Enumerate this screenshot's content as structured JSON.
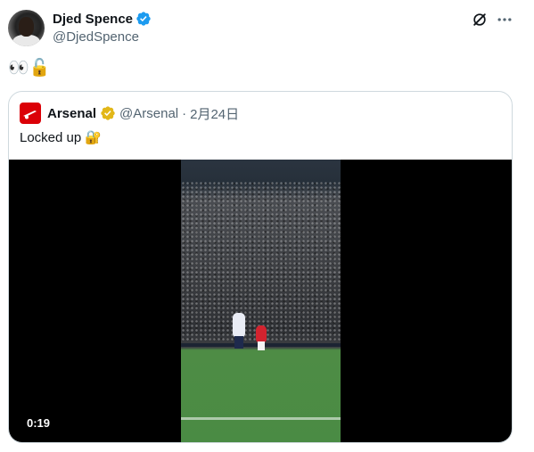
{
  "author": {
    "name": "Djed Spence",
    "handle": "@DjedSpence",
    "verified_color": "#1d9bf0"
  },
  "tweet": {
    "text": "👀🔓"
  },
  "icons": {
    "grok": "grok-icon",
    "more": "more-horizontal-icon",
    "verified": "verified-badge-icon",
    "gold_verified": "gold-verified-badge-icon",
    "club_logo": "arsenal-cannon-logo-icon"
  },
  "quote": {
    "name": "Arsenal",
    "handle": "@Arsenal",
    "separator": "·",
    "date": "2月24日",
    "text": "Locked up 🔐",
    "badge_color": "#e2b719",
    "logo_color": "#db0007"
  },
  "media": {
    "type": "video",
    "duration": "0:19"
  }
}
